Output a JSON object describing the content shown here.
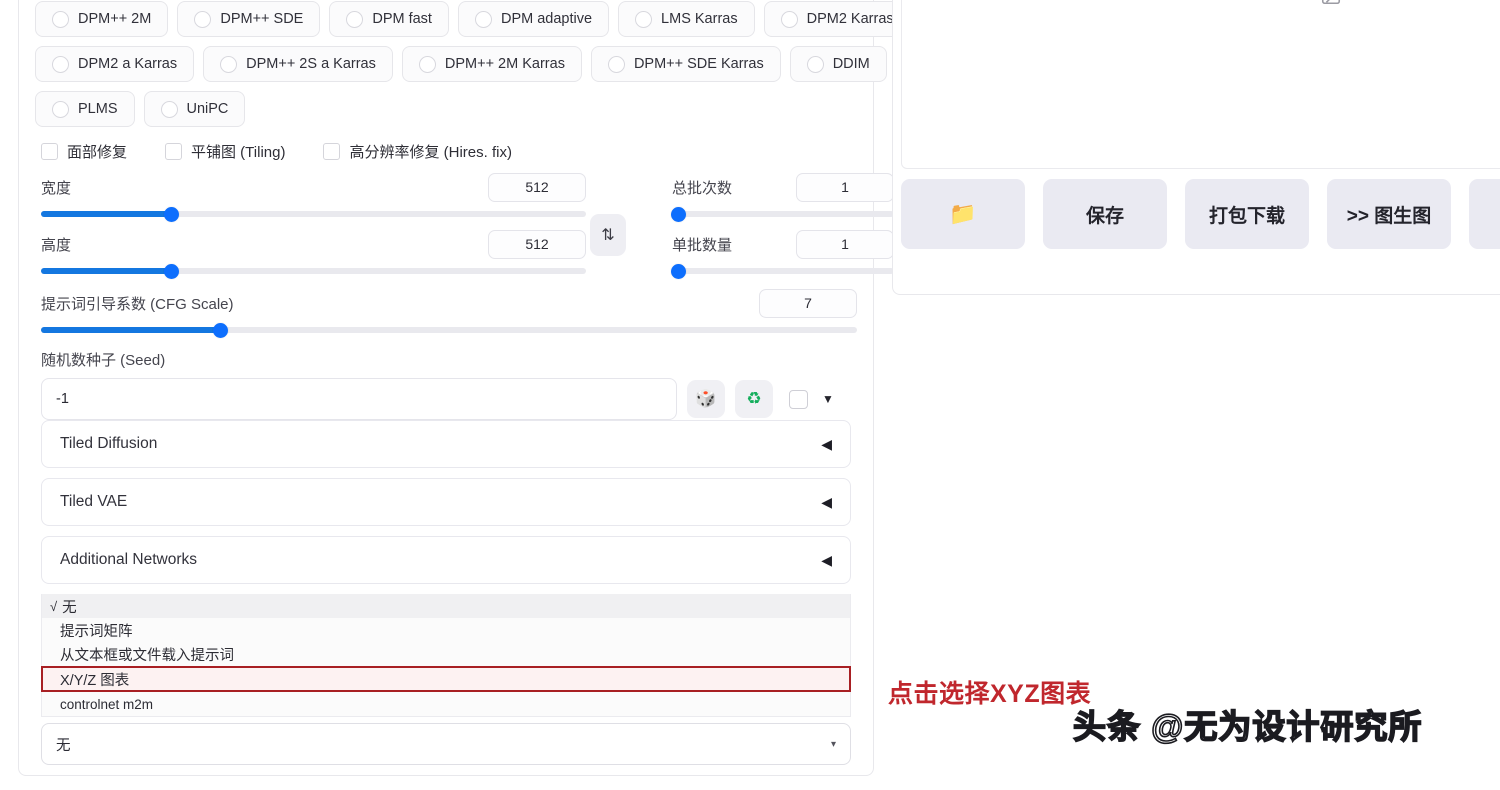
{
  "samplers": {
    "rows": [
      [
        {
          "label": "DPM++ 2M"
        },
        {
          "label": "DPM++ SDE"
        },
        {
          "label": "DPM fast"
        },
        {
          "label": "DPM adaptive"
        },
        {
          "label": "LMS Karras"
        },
        {
          "label": "DPM2 Karras"
        }
      ],
      [
        {
          "label": "DPM2 a Karras"
        },
        {
          "label": "DPM++ 2S a Karras"
        },
        {
          "label": "DPM++ 2M Karras"
        },
        {
          "label": "DPM++ SDE Karras"
        },
        {
          "label": "DDIM"
        }
      ],
      [
        {
          "label": "PLMS"
        },
        {
          "label": "UniPC"
        }
      ]
    ]
  },
  "checkboxes": [
    {
      "label": "面部修复"
    },
    {
      "label": "平铺图 (Tiling)"
    },
    {
      "label": "高分辨率修复 (Hires. fix)"
    }
  ],
  "sliders": {
    "width": {
      "label": "宽度",
      "value": "512",
      "percent": 24
    },
    "height": {
      "label": "高度",
      "value": "512",
      "percent": 24
    },
    "batch_count": {
      "label": "总批次数",
      "value": "1",
      "percent": 3
    },
    "batch_size": {
      "label": "单批数量",
      "value": "1",
      "percent": 3
    },
    "cfg_scale": {
      "label": "提示词引导系数 (CFG Scale)",
      "value": "7",
      "percent": 22
    }
  },
  "swap_button": {
    "glyph": "⇅"
  },
  "seed": {
    "label": "随机数种子 (Seed)",
    "value": "-1",
    "dice_glyph": "🎲",
    "recycle_glyph": "♻",
    "caret_glyph": "▼"
  },
  "accordions": [
    {
      "label": "Tiled Diffusion",
      "arrow": "◀"
    },
    {
      "label": "Tiled VAE",
      "arrow": "◀"
    },
    {
      "label": "Additional Networks",
      "arrow": "◀"
    }
  ],
  "script_dropdown": {
    "check_glyph": "√",
    "items": [
      {
        "label": "无",
        "state": "selected"
      },
      {
        "label": "提示词矩阵",
        "state": "normal"
      },
      {
        "label": "从文本框或文件载入提示词",
        "state": "normal"
      },
      {
        "label": "X/Y/Z 图表",
        "state": "highlighted"
      },
      {
        "label": "controlnet m2m",
        "state": "normal"
      }
    ],
    "selected_value": "无",
    "arrow_glyph": "▾"
  },
  "right_panel": {
    "image_placeholder_icon": "image-placeholder-icon",
    "buttons": [
      {
        "label": "",
        "icon": "📁",
        "kind": "folder"
      },
      {
        "label": "保存",
        "kind": "text"
      },
      {
        "label": "打包下载",
        "kind": "text"
      },
      {
        "label": ">> 图生图",
        "kind": "text"
      },
      {
        "label": "",
        "kind": "cut"
      }
    ]
  },
  "annotation": {
    "text": "点击选择XYZ图表",
    "color": "#c0272d"
  },
  "watermark": {
    "text": "头条 @无为设计研究所"
  }
}
